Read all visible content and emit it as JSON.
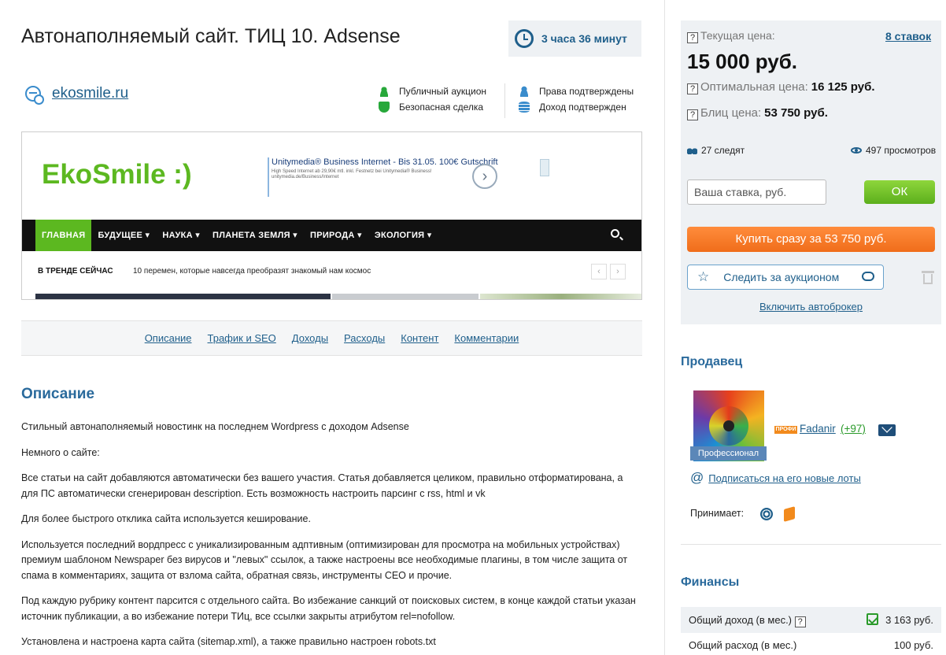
{
  "lot": {
    "title": "Автонаполняемый сайт. ТИЦ 10. Adsense",
    "time_left": "3 часа 36 минут",
    "site_url": "ekosmile.ru",
    "badges_left": [
      "Публичный аукцион",
      "Безопасная сделка"
    ],
    "badges_right": [
      "Права подтверждены",
      "Доход подтвержден"
    ]
  },
  "preview": {
    "logo": "EkoSmile :)",
    "ad_title": "Unitymedia® Business Internet - Bis 31.05. 100€ Gutschrift",
    "ad_text": "High Speed Internet ab 29,90€ mtl. inkl. Festnetz bei Unitymedia® Business! unitymedia.de/Business/Internet",
    "ad_arrow": "›",
    "nav": [
      "ГЛАВНАЯ",
      "БУДУЩЕЕ ▾",
      "НАУКА ▾",
      "ПЛАНЕТА ЗЕМЛЯ ▾",
      "ПРИРОДА ▾",
      "ЭКОЛОГИЯ ▾"
    ],
    "trend_label": "В ТРЕНДЕ СЕЙЧАС",
    "trend_text": "10 перемен, которые навсегда преобразят знакомый нам космос",
    "trend_prev": "‹",
    "trend_next": "›"
  },
  "tabs": [
    "Описание",
    "Трафик и SEO",
    "Доходы",
    "Расходы",
    "Контент",
    "Комментарии"
  ],
  "description": {
    "title": "Описание",
    "paragraphs": [
      "Стильный автонаполняемый новостинк на последнем Wordpress с доходом Adsense",
      "Немного о сайте:",
      "Все статьи на сайт добавляются автоматически без вашего участия. Статья добавляется целиком, правильно отформатирована, а для ПС автоматически сгенерирован description. Есть возможность настроить парсинг с rss, html и vk",
      "Для более быстрого отклика сайта используется кеширование.",
      "Используется последний вордпресс с уникализированным адптивным (оптимизирован для просмотра на мобильных устройствах) премиум шаблоном Newspaper без вирусов и \"левых\" ссылок, а также настроены все необходимые плагины, в том числе защита от спама в комментариях, защита от взлома сайта, обратная связь, инструменты СЕО и прочие.",
      "Под каждую рубрику контент парсится с отдельного сайта. Во избежание санкций от поисковых систем, в конце каждой статьи указан источник публикации, а во избежание потери ТИц, все ссылки закрыты атрибутом rel=nofollow.",
      "Установлена и настроена карта сайта (sitemap.xml), а также правильно настроен robots.txt"
    ]
  },
  "bidding": {
    "help_mark": "?",
    "current_price_label": "Текущая цена:",
    "bids_count": "8 ставок",
    "current_price": "15 000 руб.",
    "optimal_price_label": "Оптимальная цена:",
    "optimal_price": "16 125 руб.",
    "blitz_price_label": "Блиц цена:",
    "blitz_price": "53 750 руб.",
    "watchers": "27 следят",
    "views": "497 просмотров",
    "bid_placeholder": "Ваша ставка, руб.",
    "ok_label": "ОК",
    "buy_now_label": "Купить сразу за 53 750 руб.",
    "watch_label": "Следить за аукционом",
    "autobroker_label": "Включить автоброкер"
  },
  "seller": {
    "section_title": "Продавец",
    "level_label": "Профессионал",
    "pro_badge": "ПРОФИ",
    "name": "Fadanir",
    "rating": "(+97)",
    "subscribe_label": "Подписаться на его новые лоты",
    "accepts_label": "Принимает:"
  },
  "finance": {
    "section_title": "Финансы",
    "income_label": "Общий доход (в мес.)",
    "income_value": "3 163 руб.",
    "expense_label": "Общий расход (в мес.)",
    "expense_value": "100 руб."
  },
  "colors": {
    "accent_blue": "#1f5f8b",
    "ok_green": "#5caf1c",
    "buy_orange": "#f06d1a",
    "panel_bg": "#eef1f4"
  }
}
